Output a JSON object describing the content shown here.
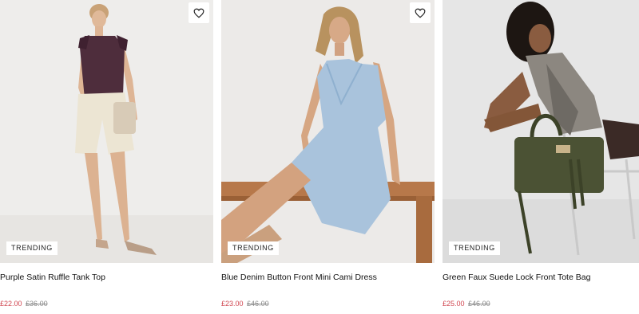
{
  "products": [
    {
      "name": "Purple Satin Ruffle Tank Top",
      "badge": "TRENDING",
      "price_now": "£22.00",
      "price_was": "£36.00"
    },
    {
      "name": "Blue Denim Button Front Mini Cami Dress",
      "badge": "TRENDING",
      "price_now": "£23.00",
      "price_was": "£46.00"
    },
    {
      "name": "Green Faux Suede Lock Front Tote Bag",
      "badge": "TRENDING",
      "price_now": "£25.00",
      "price_was": "£46.00"
    }
  ],
  "colors": {
    "sale_price": "#d0444e",
    "was_price": "#8a8a8a",
    "photo_bg": "#ececec"
  },
  "icons": {
    "wishlist": "heart-outline-icon"
  }
}
